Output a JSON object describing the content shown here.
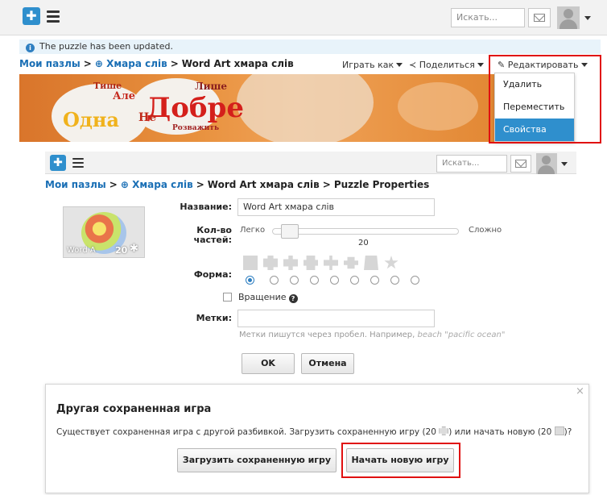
{
  "panel1": {
    "search_placeholder": "Искать...",
    "notice": "The puzzle has been updated.",
    "breadcrumb": {
      "root": "Мои пазлы",
      "folder": "Хмара слів",
      "current": "Word Art хмара слів"
    },
    "actions": {
      "play_as": "Играть как",
      "share": "Поделиться",
      "edit": "Редактировать"
    },
    "edit_menu": {
      "items": [
        "Удалить",
        "Переместить",
        "Свойства"
      ],
      "selected": "Свойства"
    },
    "banner_words": [
      "Одна",
      "Добре",
      "Лише",
      "Але",
      "Розважить",
      "Тише",
      "Не"
    ]
  },
  "panel2": {
    "search_placeholder": "Искать...",
    "breadcrumb": {
      "root": "Мои пазлы",
      "folder": "Хмара слів",
      "middle": "Word Art хмара слів",
      "current": "Puzzle Properties"
    },
    "thumb_caption": "Word A",
    "thumb_count": "20",
    "name_label": "Название:",
    "name_value": "Word Art хмара слів",
    "pieces_label_1": "Кол-во",
    "pieces_label_2": "частей:",
    "easy": "Легко",
    "hard": "Сложно",
    "pieces_value": "20",
    "pieces_fraction": 0.05,
    "shape_label": "Форма:",
    "rotation_label": "Вращение",
    "tags_label": "Метки:",
    "tags_hint": "Метки пишутся через пробел. Например,",
    "tags_example": "beach \"pacific ocean\"",
    "ok": "OK",
    "cancel": "Отмена"
  },
  "dialog": {
    "title": "Другая сохраненная игра",
    "text_1": "Существует сохраненная игра с другой разбивкой. Загрузить сохраненную игру (20",
    "text_2": ") или начать новую (20",
    "text_3": ")?",
    "load_button": "Загрузить сохраненную игру",
    "new_button": "Начать новую игру",
    "close": "×"
  },
  "colors": {
    "accent_blue": "#2f8fcd",
    "link_blue": "#1a6fb5",
    "highlight_red": "#e01010",
    "banner_orange": "#e8913e"
  }
}
